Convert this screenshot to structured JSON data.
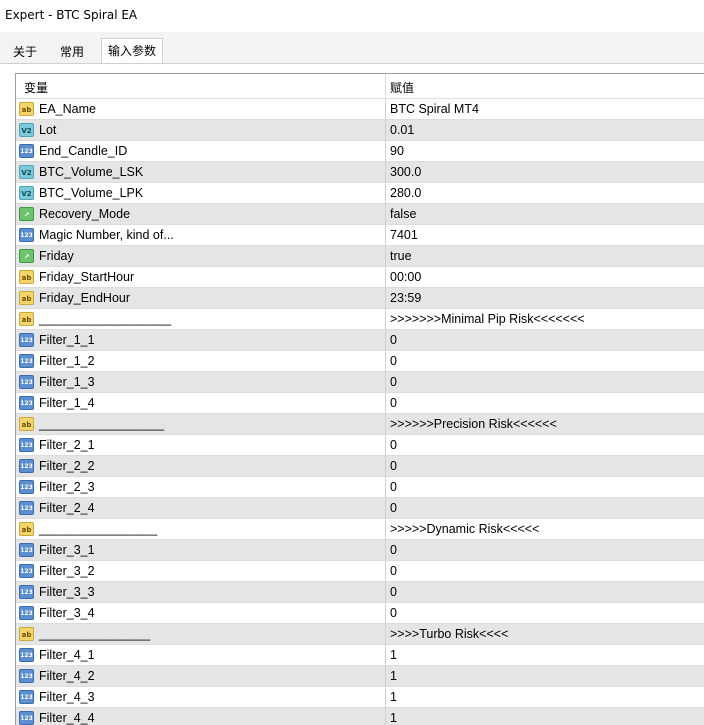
{
  "window": {
    "title": "Expert - BTC Spiral EA"
  },
  "tabs": [
    {
      "label": "关于"
    },
    {
      "label": "常用"
    },
    {
      "label": "输入参数"
    }
  ],
  "table": {
    "headers": {
      "variable": "变量",
      "value": "赋值"
    },
    "rows": [
      {
        "icon": "ab",
        "name": "EA_Name",
        "value": "BTC Spiral MT4"
      },
      {
        "icon": "v2",
        "name": "Lot",
        "value": "0.01"
      },
      {
        "icon": "123",
        "name": "End_Candle_ID",
        "value": "90"
      },
      {
        "icon": "v2",
        "name": "BTC_Volume_LSK",
        "value": "300.0"
      },
      {
        "icon": "v2",
        "name": "BTC_Volume_LPK",
        "value": "280.0"
      },
      {
        "icon": "bool",
        "name": "Recovery_Mode",
        "value": "false"
      },
      {
        "icon": "123",
        "name": "Magic Number, kind of...",
        "value": "7401"
      },
      {
        "icon": "bool",
        "name": "Friday",
        "value": "true"
      },
      {
        "icon": "ab",
        "name": "Friday_StartHour",
        "value": "00:00"
      },
      {
        "icon": "ab",
        "name": "Friday_EndHour",
        "value": "23:59"
      },
      {
        "icon": "ab",
        "name": "___________________",
        "value": ">>>>>>>Minimal Pip Risk<<<<<<<"
      },
      {
        "icon": "123",
        "name": "Filter_1_1",
        "value": "0"
      },
      {
        "icon": "123",
        "name": "Filter_1_2",
        "value": "0"
      },
      {
        "icon": "123",
        "name": "Filter_1_3",
        "value": "0"
      },
      {
        "icon": "123",
        "name": "Filter_1_4",
        "value": "0"
      },
      {
        "icon": "ab",
        "name": "__________________",
        "value": ">>>>>>Precision Risk<<<<<<"
      },
      {
        "icon": "123",
        "name": "Filter_2_1",
        "value": "0"
      },
      {
        "icon": "123",
        "name": "Filter_2_2",
        "value": "0"
      },
      {
        "icon": "123",
        "name": "Filter_2_3",
        "value": "0"
      },
      {
        "icon": "123",
        "name": "Filter_2_4",
        "value": "0"
      },
      {
        "icon": "ab",
        "name": "_________________",
        "value": ">>>>>Dynamic Risk<<<<<"
      },
      {
        "icon": "123",
        "name": "Filter_3_1",
        "value": "0"
      },
      {
        "icon": "123",
        "name": "Filter_3_2",
        "value": "0"
      },
      {
        "icon": "123",
        "name": "Filter_3_3",
        "value": "0"
      },
      {
        "icon": "123",
        "name": "Filter_3_4",
        "value": "0"
      },
      {
        "icon": "ab",
        "name": "________________",
        "value": ">>>>Turbo Risk<<<<"
      },
      {
        "icon": "123",
        "name": "Filter_4_1",
        "value": "1"
      },
      {
        "icon": "123",
        "name": "Filter_4_2",
        "value": "1"
      },
      {
        "icon": "123",
        "name": "Filter_4_3",
        "value": "1"
      },
      {
        "icon": "123",
        "name": "Filter_4_4",
        "value": "1"
      }
    ]
  }
}
